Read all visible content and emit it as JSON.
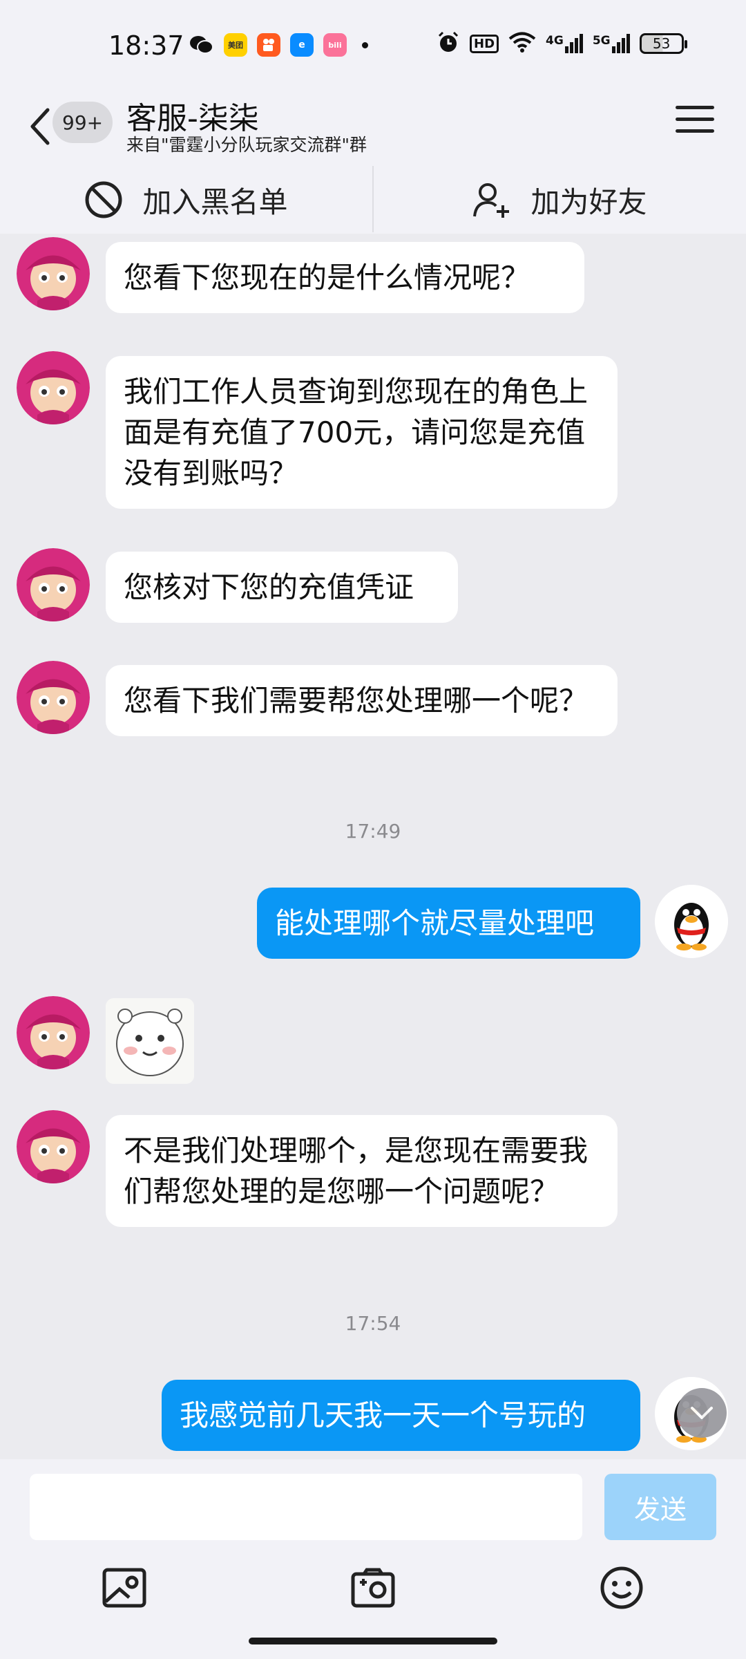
{
  "status_bar": {
    "time": "18:37",
    "apps": [
      {
        "icon": "wechat-icon",
        "label": ""
      },
      {
        "icon": "meituan-icon",
        "label": "美团"
      },
      {
        "icon": "kuaishou-icon",
        "label": ""
      },
      {
        "icon": "eleme-icon",
        "label": "e"
      },
      {
        "icon": "bilibili-icon",
        "label": "bili"
      }
    ],
    "network": "4G",
    "network2": "5G",
    "hd": "HD",
    "battery": "53"
  },
  "header": {
    "back_badge": "99+",
    "title": "客服-柒柒",
    "subtitle": "来自\"雷霆小分队玩家交流群\"群"
  },
  "actions": {
    "blacklist": "加入黑名单",
    "add_friend": "加为好友"
  },
  "messages": [
    {
      "side": "left",
      "text": "您看下您现在的是什么情况呢？"
    },
    {
      "side": "left",
      "text": "我们工作人员查询到您现在的角色上面是有充值了700元，请问您是充值没有到账吗？"
    },
    {
      "side": "left",
      "text": "您核对下您的充值凭证"
    },
    {
      "side": "left",
      "text": "您看下我们需要帮您处理哪一个呢？"
    },
    {
      "side": "time",
      "text": "17:49"
    },
    {
      "side": "right",
      "text": "能处理哪个就尽量处理吧"
    },
    {
      "side": "left",
      "type": "sticker",
      "text": ""
    },
    {
      "side": "left",
      "text": "不是我们处理哪个，是您现在需要我们帮您处理的是您哪一个问题呢？"
    },
    {
      "side": "time",
      "text": "17:54"
    },
    {
      "side": "right",
      "text": "我感觉前几天我一天一个号玩的"
    }
  ],
  "input": {
    "value": "",
    "send_label": "发送"
  },
  "colors": {
    "accent": "#0a97f5",
    "send_disabled": "#9cd3fa",
    "chat_bg": "#ebebef"
  }
}
